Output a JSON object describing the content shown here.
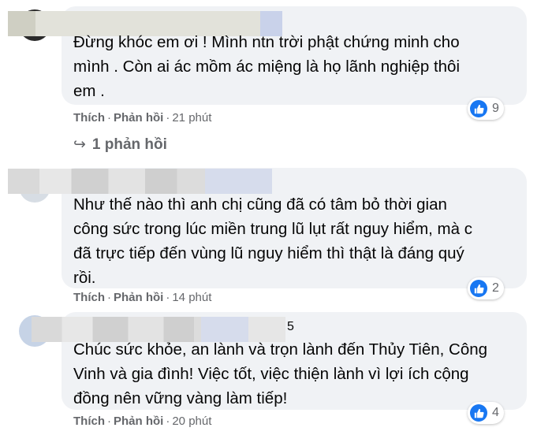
{
  "comments": [
    {
      "text": "Đừng khóc em ơi ! Mình ntn trời phật chứng minh cho\nmình . Còn ai ác mồm ác miệng là họ lãnh nghiệp thôi\nem .",
      "like_label": "Thích",
      "reply_label": "Phản hồi",
      "time": "21 phút",
      "reaction_count": "9"
    },
    {
      "text": "Như thế nào thì anh chị cũng đã có tâm bỏ thời gian\ncông sức trong lúc miền trung lũ lụt rất nguy hiểm, mà c\nđã trực tiếp đến vùng lũ nguy hiểm thì thật là đáng quý\nrồi.",
      "like_label": "Thích",
      "reply_label": "Phản hồi",
      "time": "14 phút",
      "reaction_count": "2"
    },
    {
      "name_suffix": "5",
      "text": "Chúc sức khỏe, an lành và trọn lành đến Thủy Tiên, Công\nVinh và gia đình! Việc tốt, việc thiện lành vì lợi ích cộng\nđồng nên vững vàng làm tiếp!",
      "like_label": "Thích",
      "reply_label": "Phản hồi",
      "time": "20 phút",
      "reaction_count": "4"
    }
  ],
  "replies_link": "1 phản hồi",
  "reaction_icon": "like-icon",
  "colors": {
    "bubble": "#f0f2f5",
    "meta": "#65676b",
    "like_blue": "#1877f2"
  }
}
